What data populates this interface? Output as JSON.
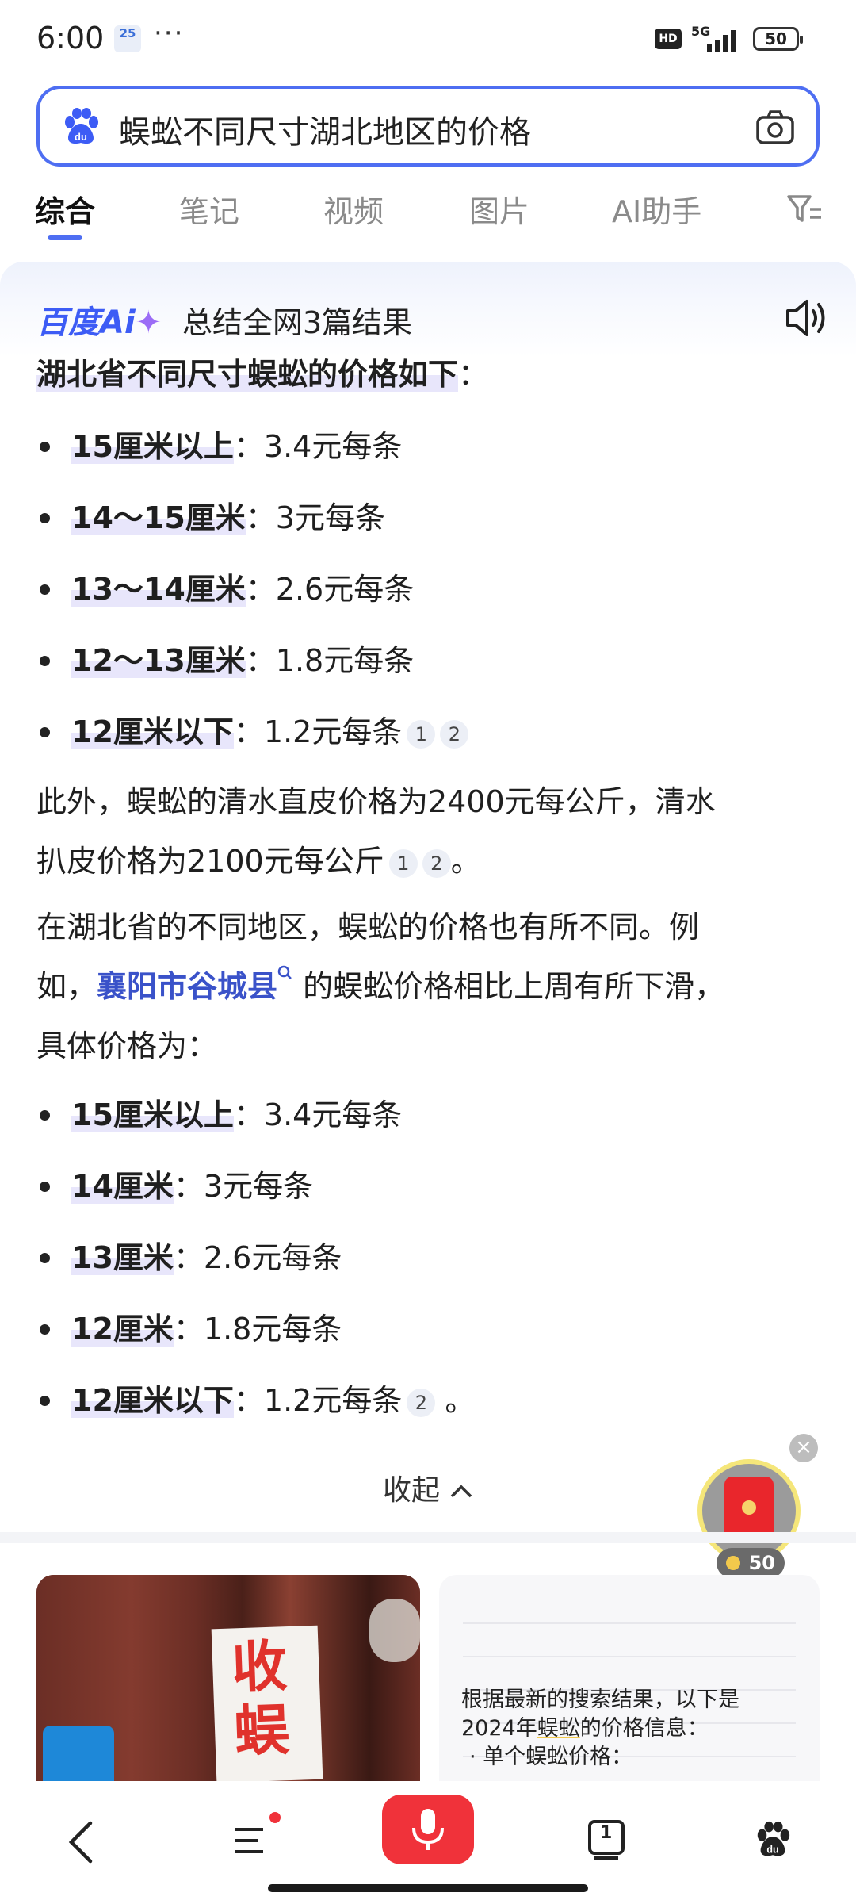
{
  "status": {
    "time": "6:00",
    "calendar_badge": "25",
    "more": "···",
    "hd": "HD",
    "network": "5G",
    "battery": "50"
  },
  "search": {
    "query": "蜈蚣不同尺寸湖北地区的价格"
  },
  "tabs": [
    {
      "label": "综合"
    },
    {
      "label": "笔记"
    },
    {
      "label": "视频"
    },
    {
      "label": "图片"
    },
    {
      "label": "AI助手"
    }
  ],
  "ai_card": {
    "logo_text": "百度Ai",
    "logo_spark": "✦",
    "summary": "总结全网3篇结果",
    "heading": "湖北省不同尺寸蜈蚣的价格如下",
    "heading_suffix": "：",
    "list1": [
      {
        "label": "15厘米以上",
        "value": "：3.4元每条"
      },
      {
        "label": "14～15厘米",
        "value": "：3元每条"
      },
      {
        "label": "13～14厘米",
        "value": "：2.6元每条"
      },
      {
        "label": "12～13厘米",
        "value": "：1.8元每条"
      },
      {
        "label": "12厘米以下",
        "value": "：1.2元每条"
      }
    ],
    "list1_cites": [
      "1",
      "2"
    ],
    "para1_line1": "此外，蜈蚣的清水直皮价格为2400元每公斤，清水",
    "para1_line2": "扒皮价格为2100元每公斤",
    "para1_cites": [
      "1",
      "2"
    ],
    "para1_end": "。",
    "para2_line1": "在湖北省的不同地区，蜈蚣的价格也有所不同。例",
    "para2_prefix": "如，",
    "para2_link": "襄阳市谷城县",
    "para2_after": " 的蜈蚣价格相比上周有所下滑，",
    "para2_line3": "具体价格为：",
    "list2": [
      {
        "label": "15厘米以上",
        "value": "：3.4元每条"
      },
      {
        "label": "14厘米",
        "value": "：3元每条"
      },
      {
        "label": "13厘米",
        "value": "：2.6元每条"
      },
      {
        "label": "12厘米",
        "value": "：1.8元每条"
      },
      {
        "label": "12厘米以下",
        "value": "：1.2元每条"
      }
    ],
    "list2_cite": "2",
    "list2_end": "。",
    "collapse": "收起",
    "collapse_icon": "^"
  },
  "floating": {
    "close": "×",
    "coins": "50"
  },
  "cards": {
    "left_sign": "收\n蜈",
    "right_line1": "根据最新的搜索结果，以下是",
    "right_line2_pre": "2024年",
    "right_line2_hl": "蜈蚣",
    "right_line2_post": "的价格信息：",
    "right_line3": "· 单个蜈蚣价格："
  },
  "bottom_nav": {
    "tabs_count": "1"
  },
  "colors": {
    "accent": "#4e6ef2",
    "link": "#3a52c9",
    "red": "#f0323a"
  }
}
